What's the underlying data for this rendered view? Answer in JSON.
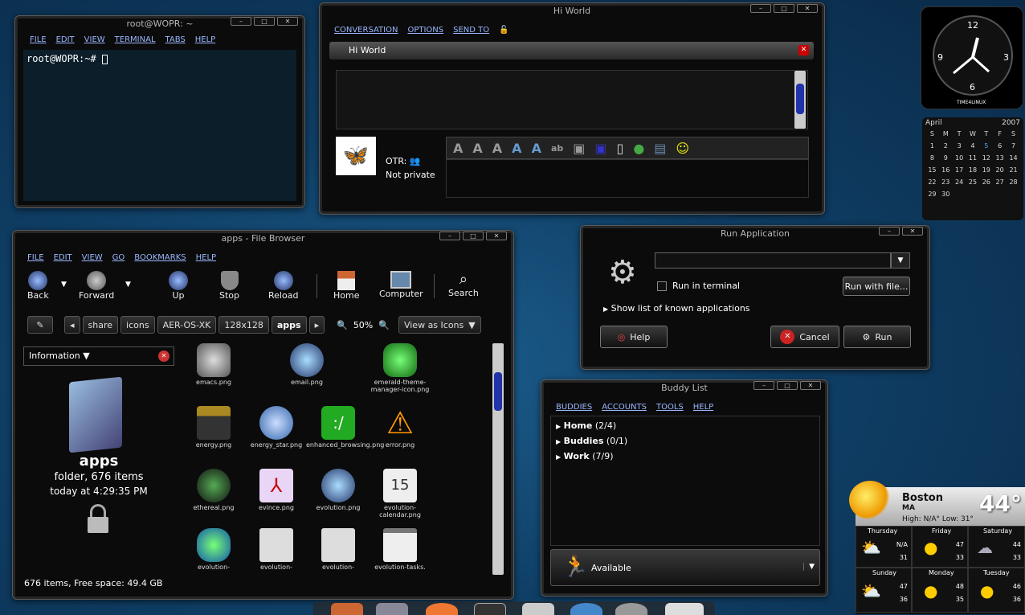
{
  "terminal": {
    "title": "root@WOPR: ~",
    "menu": [
      "FILE",
      "EDIT",
      "VIEW",
      "TERMINAL",
      "TABS",
      "HELP"
    ],
    "prompt": "root@WOPR:~#"
  },
  "chat": {
    "title": "Hi World",
    "menu": [
      "CONVERSATION",
      "OPTIONS",
      "SEND TO"
    ],
    "tab": "Hi World",
    "otr_label": "OTR:",
    "privacy": "Not private"
  },
  "clock": {
    "n12": "12",
    "n3": "3",
    "n6": "6",
    "n9": "9",
    "brand": "TIME4LINUX"
  },
  "calendar": {
    "month": "April",
    "year": "2007",
    "days": [
      "S",
      "M",
      "T",
      "W",
      "T",
      "F",
      "S"
    ],
    "weeks": [
      [
        "1",
        "2",
        "3",
        "4",
        "5",
        "6",
        "7"
      ],
      [
        "8",
        "9",
        "10",
        "11",
        "12",
        "13",
        "14"
      ],
      [
        "15",
        "16",
        "17",
        "18",
        "19",
        "20",
        "21"
      ],
      [
        "22",
        "23",
        "24",
        "25",
        "26",
        "27",
        "28"
      ],
      [
        "29",
        "30",
        "",
        "",
        "",
        "",
        ""
      ]
    ],
    "today": "5"
  },
  "filebrowser": {
    "title": "apps - File Browser",
    "menu": [
      "FILE",
      "EDIT",
      "VIEW",
      "GO",
      "BOOKMARKS",
      "HELP"
    ],
    "toolbar": {
      "back": "Back",
      "forward": "Forward",
      "up": "Up",
      "stop": "Stop",
      "reload": "Reload",
      "home": "Home",
      "computer": "Computer",
      "search": "Search"
    },
    "path": [
      "share",
      "icons",
      "AER-OS-XK",
      "128x128",
      "apps"
    ],
    "zoom": "50%",
    "view_mode": "View as Icons",
    "side_panel": "Information",
    "folder_name": "apps",
    "folder_info": "folder, 676 items",
    "folder_date": "today at 4:29:35 PM",
    "files": [
      "emacs.png",
      "email.png",
      "emerald-theme-manager-icon.png",
      "energy.png",
      "energy_star.png",
      "enhanced_browsing.png",
      "error.png",
      "ethereal.png",
      "evince.png",
      "evolution.png",
      "evolution-calendar.png",
      "evolution-",
      "evolution-",
      "evolution-",
      "evolution-tasks."
    ],
    "status": "676 items, Free space: 49.4 GB"
  },
  "run": {
    "title": "Run Application",
    "run_in_terminal": "Run in terminal",
    "run_with_file": "Run with file...",
    "show_list": "Show list of known applications",
    "help": "Help",
    "cancel": "Cancel",
    "run": "Run"
  },
  "buddy": {
    "title": "Buddy List",
    "menu": [
      "BUDDIES",
      "ACCOUNTS",
      "TOOLS",
      "HELP"
    ],
    "groups": [
      {
        "name": "Home",
        "count": "(2/4)"
      },
      {
        "name": "Buddies",
        "count": "(0/1)"
      },
      {
        "name": "Work",
        "count": "(7/9)"
      }
    ],
    "status": "Available"
  },
  "weather": {
    "city": "Boston",
    "state": "MA",
    "temp": "44°",
    "highlow": "High: N/A°  Low: 31°",
    "forecast": [
      {
        "day": "Thursday",
        "hi": "N/A",
        "lo": "31"
      },
      {
        "day": "Friday",
        "hi": "47",
        "lo": "33"
      },
      {
        "day": "Saturday",
        "hi": "44",
        "lo": "33"
      },
      {
        "day": "Sunday",
        "hi": "47",
        "lo": "36"
      },
      {
        "day": "Monday",
        "hi": "48",
        "lo": "35"
      },
      {
        "day": "Tuesday",
        "hi": "46",
        "lo": "36"
      }
    ]
  }
}
